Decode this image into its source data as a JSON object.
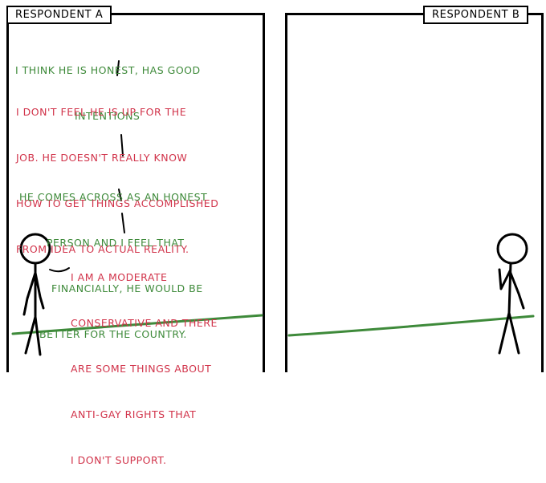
{
  "panels": {
    "a": {
      "label": "RESPONDENT A",
      "statements": [
        {
          "color": "#3e8a3a",
          "lines": [
            "I THINK HE IS HONEST, HAS GOOD",
            "INTENTIONS"
          ]
        },
        {
          "color": "#d1334a",
          "lines": [
            "I DON'T FEEL HE IS UP FOR THE",
            "JOB. HE DOESN'T REALLY KNOW",
            "HOW TO GET THINGS ACCOMPLISHED",
            "FROM IDEA TO ACTUAL REALITY."
          ]
        },
        {
          "color": "#3e8a3a",
          "lines": [
            "HE COMES ACROSS AS AN HONEST",
            "PERSON AND I FEEL THAT",
            "FINANCIALLY, HE WOULD BE",
            "BETTER FOR THE COUNTRY."
          ]
        },
        {
          "color": "#d1334a",
          "lines": [
            "I AM A MODERATE",
            "CONSERVATIVE AND THERE",
            "ARE SOME THINGS ABOUT",
            "ANTI-GAY RIGHTS THAT",
            "I DON'T SUPPORT."
          ]
        }
      ]
    },
    "b": {
      "label": "RESPONDENT B"
    }
  },
  "colors": {
    "ground": "#3e8a3a",
    "positive": "#3e8a3a",
    "negative": "#d1334a"
  }
}
